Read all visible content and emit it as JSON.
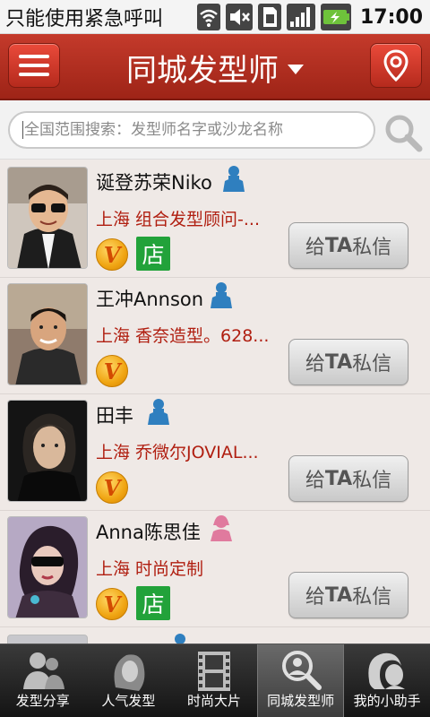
{
  "status_bar": {
    "carrier_text": "只能使用紧急呼叫",
    "time": "17:00"
  },
  "header": {
    "title": "同城发型师"
  },
  "search": {
    "placeholder": "全国范围搜索：发型师名字或沙龙名称"
  },
  "stylists": [
    {
      "name": "诞登苏荣Niko",
      "gender": "male",
      "salon": "上海 组合发型顾问-...",
      "verified": true,
      "shop": true,
      "action_label_bold": "TA",
      "action_prefix": "给",
      "action_suffix": "私信"
    },
    {
      "name": "王冲Annson",
      "gender": "male",
      "salon": "上海 香奈造型。628...",
      "verified": true,
      "shop": false,
      "action_label_bold": "TA",
      "action_prefix": "给",
      "action_suffix": "私信"
    },
    {
      "name": "田丰",
      "gender": "male",
      "salon": "上海 乔微尔JOVIAL...",
      "verified": true,
      "shop": false,
      "action_label_bold": "TA",
      "action_prefix": "给",
      "action_suffix": "私信"
    },
    {
      "name": "Anna陈思佳",
      "gender": "female",
      "salon": "上海 时尚定制",
      "verified": true,
      "shop": true,
      "action_label_bold": "TA",
      "action_prefix": "给",
      "action_suffix": "私信"
    }
  ],
  "badges": {
    "verified": "V",
    "shop": "店"
  },
  "bottom_nav": [
    {
      "label": "发型分享",
      "icon": "people-icon",
      "active": false
    },
    {
      "label": "人气发型",
      "icon": "hair-portrait-icon",
      "active": false
    },
    {
      "label": "时尚大片",
      "icon": "film-icon",
      "active": false
    },
    {
      "label": "同城发型师",
      "icon": "stylist-search-icon",
      "active": true
    },
    {
      "label": "我的小助手",
      "icon": "assistant-icon",
      "active": false
    }
  ],
  "colors": {
    "header_red": "#b32e20",
    "salon_text": "#b01e10",
    "male_icon": "#2f7fbf",
    "female_icon": "#e07a9e",
    "shop_green": "#22a23a",
    "verified_gold": "#f0a513"
  }
}
